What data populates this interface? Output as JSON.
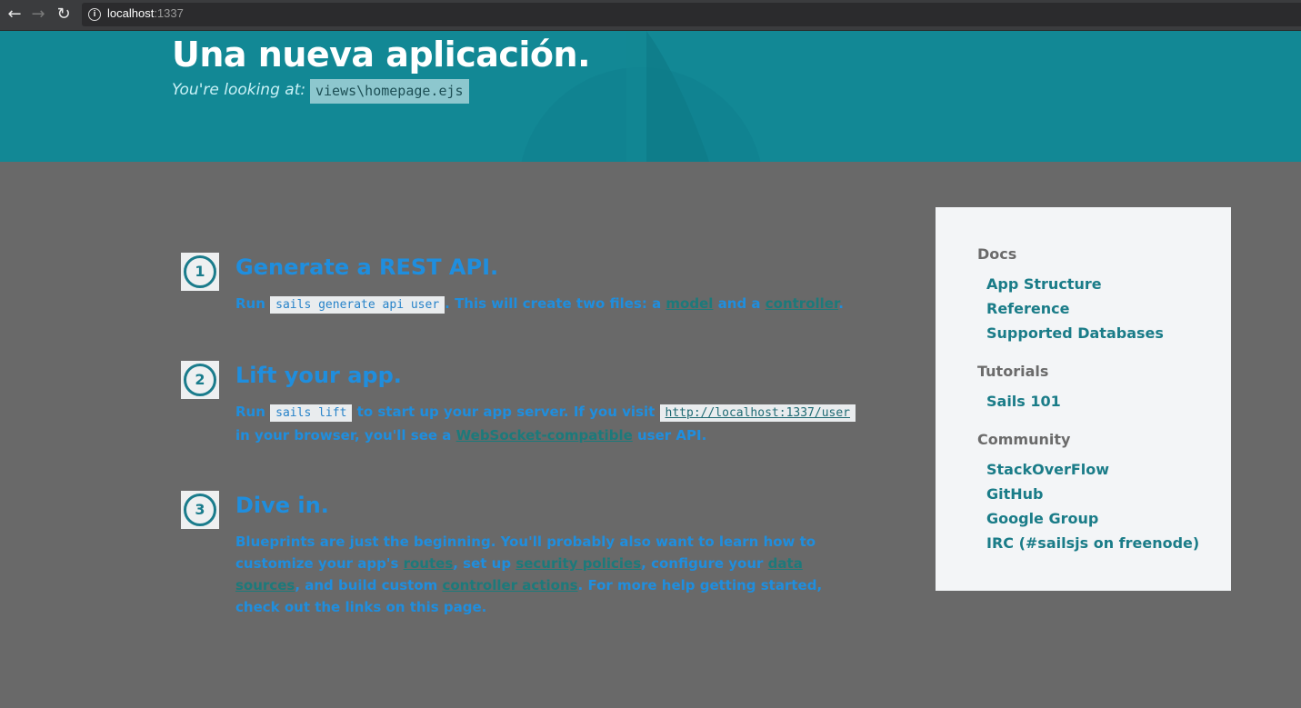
{
  "browser": {
    "url_host": "localhost",
    "url_port": ":1337",
    "back_icon": "arrow-left",
    "forward_icon": "arrow-right",
    "reload_icon": "reload",
    "info_icon": "info-circle"
  },
  "header": {
    "title": "Una nueva aplicación.",
    "subtitle": "You're looking at:",
    "file": "views\\homepage.ejs"
  },
  "steps": [
    {
      "number": "1",
      "title": "Generate a REST API.",
      "p1": "Run ",
      "code": "sails generate api user",
      "p2": ". This will create two files: a ",
      "link1": "model",
      "p3": " and a ",
      "link2": "controller",
      "p4": "."
    },
    {
      "number": "2",
      "title": "Lift your app.",
      "p1": "Run ",
      "code": "sails lift",
      "p2": " to start up your app server. If you visit ",
      "code_link": "http://localhost:1337/user",
      "p3": " in your browser, you'll see a ",
      "link1": "WebSocket-compatible",
      "p4": " user API."
    },
    {
      "number": "3",
      "title": "Dive in.",
      "p1": "Blueprints are just the beginning. You'll probably also want to learn how to customize your app's ",
      "link1": "routes",
      "p2": ", set up ",
      "link2": "security policies",
      "p3": ", configure your ",
      "link3": "data sources",
      "p4": ", and build custom ",
      "link4": "controller actions",
      "p5": ". For more help getting started, check out the links on this page."
    }
  ],
  "sidebar": {
    "docs_heading": "Docs",
    "docs_links": [
      "App Structure",
      "Reference",
      "Supported Databases"
    ],
    "tutorials_heading": "Tutorials",
    "tutorials_links": [
      "Sails 101"
    ],
    "community_heading": "Community",
    "community_links": [
      "StackOverFlow",
      "GitHub",
      "Google Group",
      "IRC (#sailsjs on freenode)"
    ]
  },
  "colors": {
    "header_bg": "#128895",
    "page_bg": "#696969",
    "step_text": "#1f8ede",
    "sidebar_link": "#1a7c88"
  }
}
